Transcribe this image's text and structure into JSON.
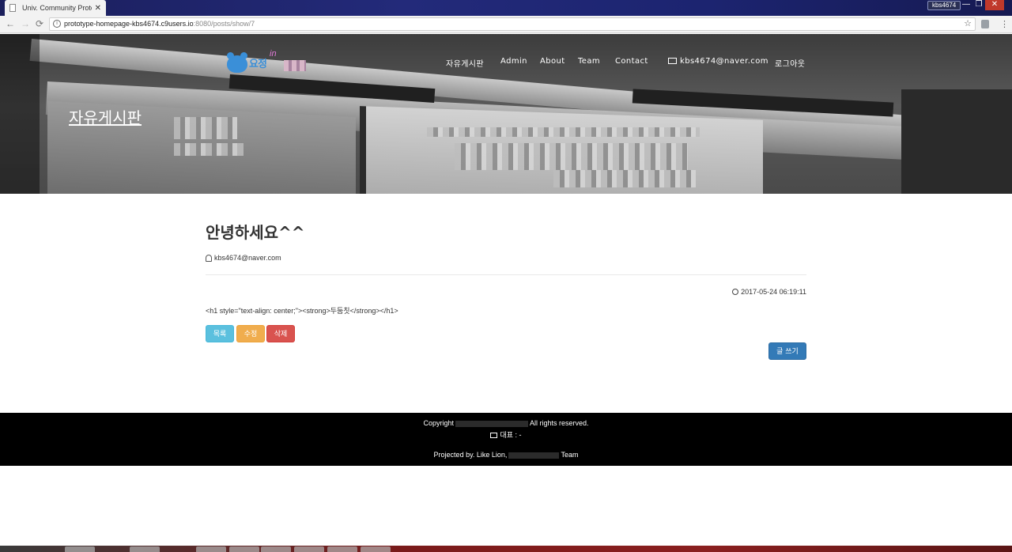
{
  "browser": {
    "tab_title": "Univ. Community Protot",
    "tab_close": "✕",
    "user_badge": "kbs4674",
    "url_host": "prototype-homepage-kbs4674.c9users.io",
    "url_rest": ":8080/posts/show/7",
    "window_controls": [
      "—",
      "❐",
      "✕"
    ]
  },
  "site": {
    "logo_text": "요정",
    "logo_scribble": "in",
    "nav": [
      "자유게시판",
      "Admin",
      "About",
      "Team",
      "Contact"
    ],
    "user_email": "kbs4674@naver.com",
    "logout": "로그아웃",
    "hero_title": "자유게시판"
  },
  "post": {
    "title": "안녕하세요^^",
    "author": "kbs4674@naver.com",
    "date": "2017-05-24 06:19:11",
    "body": "<h1 style=\"text-align: center;\"><strong>두둠칫</strong></h1>",
    "buttons": {
      "list": "목록",
      "edit": "수정",
      "delete": "삭제",
      "write": "글 쓰기"
    }
  },
  "footer": {
    "copyright_left": "Copyright",
    "copyright_right": "All rights reserved.",
    "rep": "대표 : -",
    "projected_left": "Projected by. Like Lion,",
    "projected_right": "Team"
  },
  "colors": {
    "btn_info": "#5bc0de",
    "btn_warning": "#f0ad4e",
    "btn_danger": "#d9534f",
    "btn_primary": "#337ab7",
    "footer_bg": "#000000"
  },
  "icons": {
    "back": "←",
    "forward": "→",
    "reload": "⟳",
    "info": "i",
    "star": "☆",
    "menu": "⋮"
  }
}
